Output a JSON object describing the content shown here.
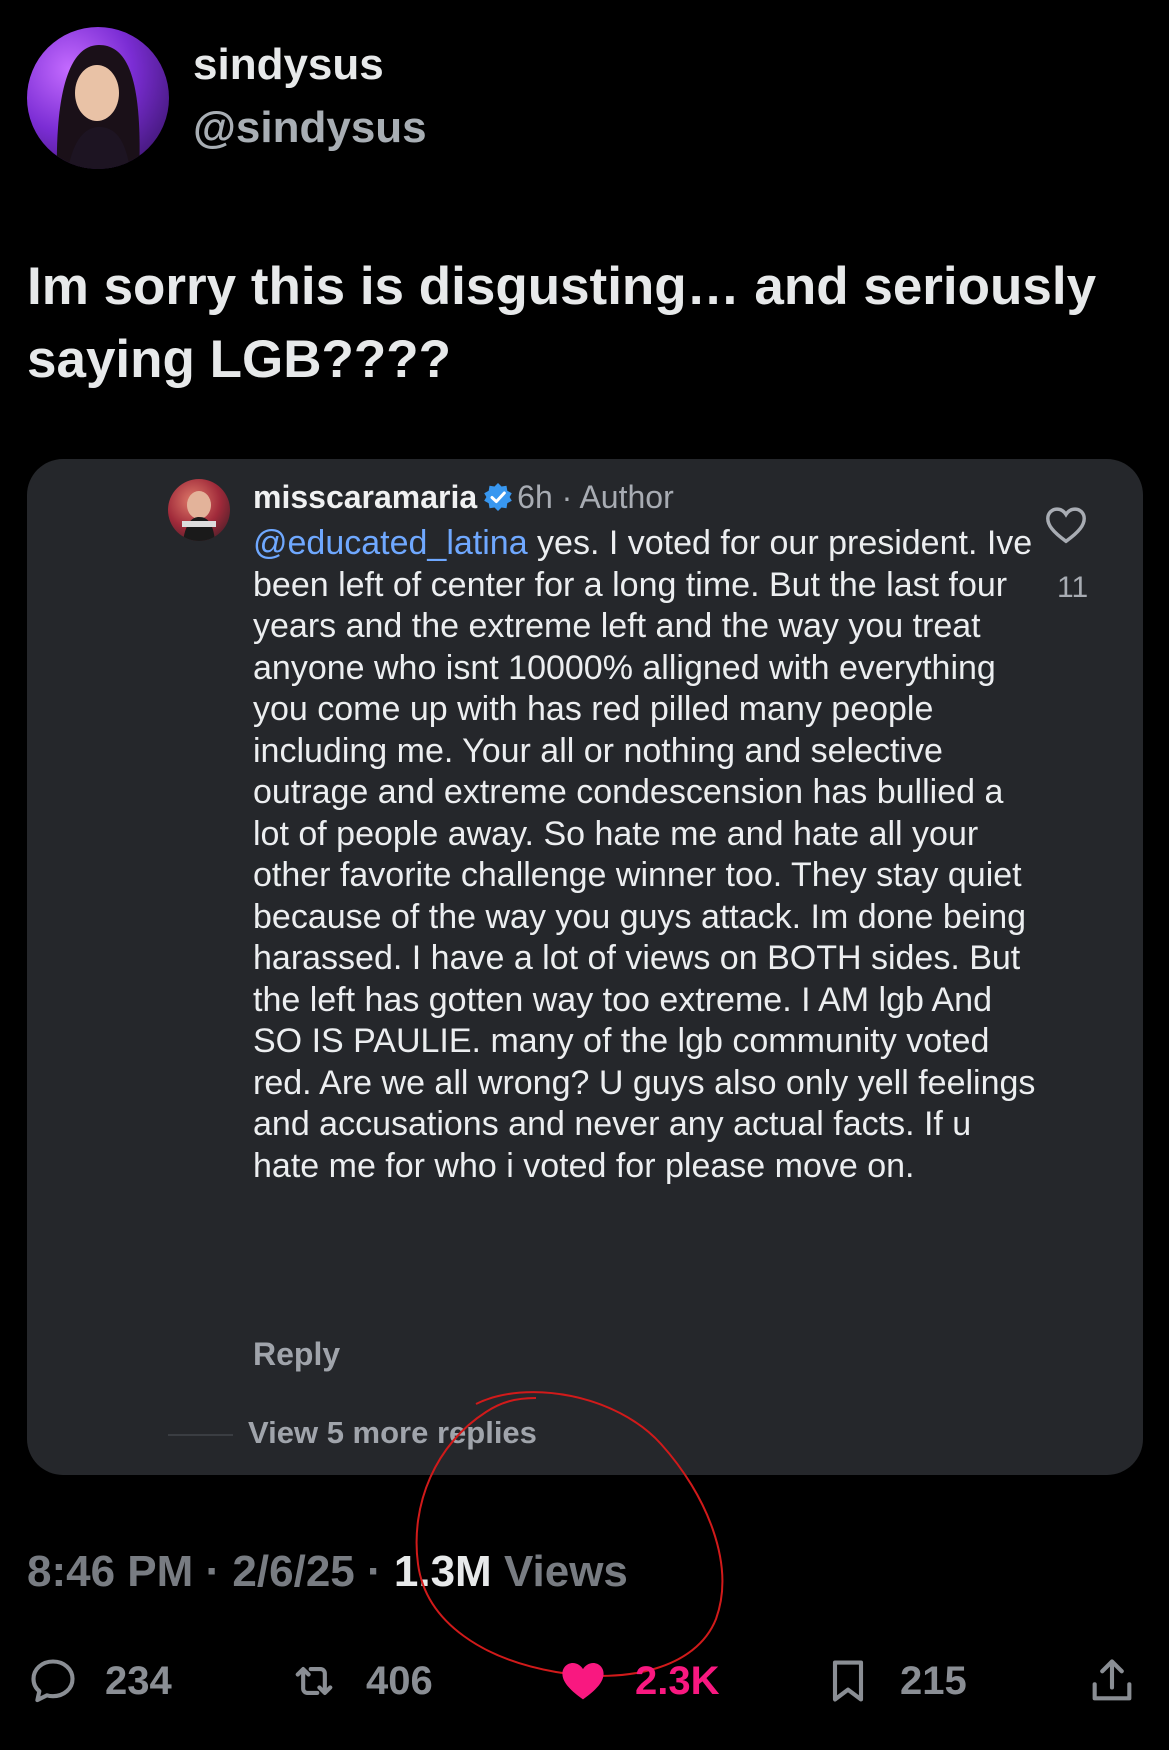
{
  "author": {
    "name": "sindysus",
    "handle": "@sindysus"
  },
  "tweet": {
    "text": "Im sorry this is disgusting… and seriously saying LGB????"
  },
  "quoted_comment": {
    "username": "misscaramaria",
    "time": "6h",
    "separator": "·",
    "tag": "Author",
    "mention": "@educated_latina",
    "body": " yes. I voted for our president. Ive been left of center for a long time. But the last four years and the extreme left and the way you treat anyone who isnt 10000% alligned with everything you come up with has red pilled many people including me. Your all or nothing and selective outrage and extreme condescension has bullied a lot of people away.  So hate me and hate all your other favorite challenge winner too. They stay quiet because of the way you guys attack. Im done being harassed. I have a lot of views on BOTH sides. But the left has gotten way too extreme. I AM lgb And SO IS PAULIE. many of the lgb community voted red. Are we all wrong? U guys also only yell feelings and accusations and never any actual facts. If u hate me for who i voted for please move on.",
    "like_count": "11",
    "reply_label": "Reply",
    "view_more_label": "View 5 more replies"
  },
  "meta": {
    "time": "8:46 PM",
    "date": "2/6/25",
    "dot": "·",
    "views_count": "1.3M",
    "views_label": "Views"
  },
  "actions": {
    "replies": "234",
    "reposts": "406",
    "likes": "2.3K",
    "bookmarks": "215"
  },
  "colors": {
    "like": "#f91880",
    "mention": "#6fa8ff",
    "annotation": "#d11a1a",
    "card_bg": "#25272b"
  },
  "icons": [
    "reply-icon",
    "repost-icon",
    "heart-icon",
    "bookmark-icon",
    "share-icon",
    "verified-icon"
  ]
}
